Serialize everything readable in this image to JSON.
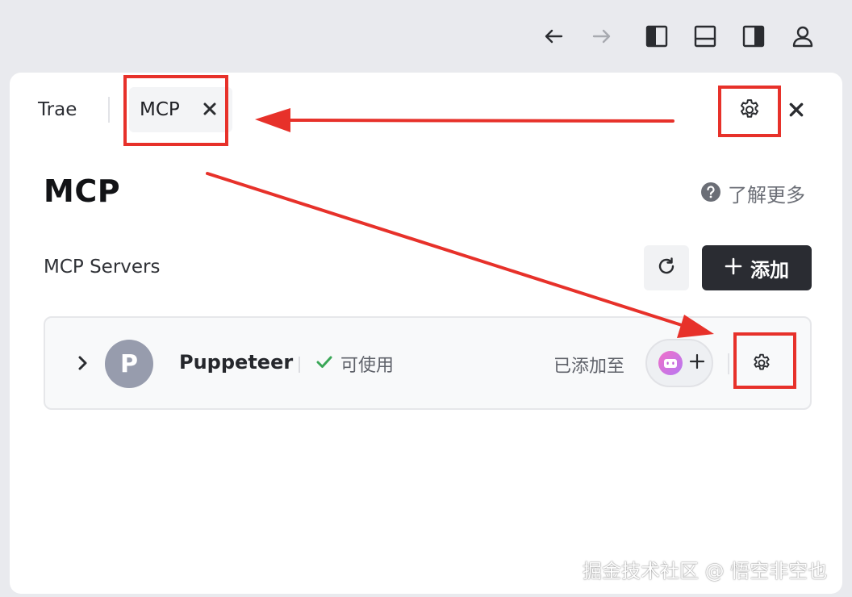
{
  "tabs": {
    "trae_label": "Trae",
    "mcp_label": "MCP"
  },
  "page": {
    "title": "MCP",
    "learn_more": "了解更多"
  },
  "servers_section": {
    "title": "MCP Servers",
    "add_label": "添加"
  },
  "servers": [
    {
      "avatar_letter": "P",
      "name": "Puppeteer",
      "status": "可使用",
      "added_to_label": "已添加至"
    }
  ],
  "watermark": "掘金技术社区 @ 悟空非空也",
  "colors": {
    "annotation": "#e7312a",
    "primary_button": "#2a2c32",
    "status_ok": "#3aa757",
    "avatar_bg": "#979cad"
  },
  "icons": {
    "toolbar": [
      "arrow-left-icon",
      "arrow-right-icon",
      "layout-left-icon",
      "layout-bottom-icon",
      "layout-right-icon",
      "user-icon"
    ],
    "tab_close": "close-icon",
    "header_settings": "gear-icon",
    "header_close": "close-icon",
    "help": "question-circle-icon",
    "refresh": "refresh-icon",
    "add": "plus-icon",
    "expand": "chevron-right-icon",
    "status": "check-icon",
    "agent": "robot-icon",
    "server_settings": "gear-icon"
  }
}
